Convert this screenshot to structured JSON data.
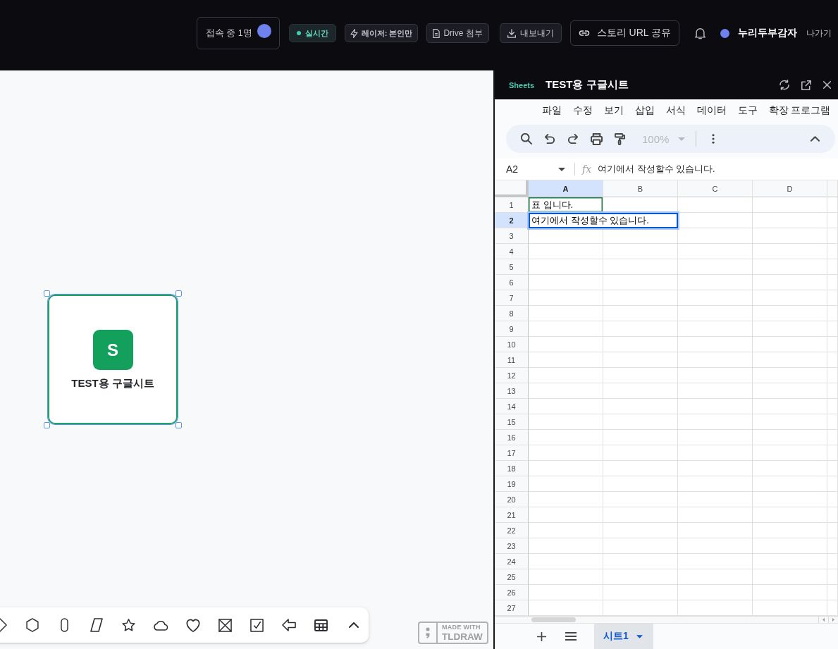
{
  "top_bar": {
    "presence": {
      "label": "접속 중 1명"
    },
    "actions": [
      {
        "kind": "live",
        "label": "실시간"
      },
      {
        "kind": "laser",
        "label": "레이저: 본인만"
      },
      {
        "kind": "drive",
        "label": "Drive 첨부"
      },
      {
        "kind": "export",
        "label": "내보내기"
      },
      {
        "kind": "share",
        "label": "스토리 URL 공유"
      }
    ],
    "user": {
      "name": "누리두부감자",
      "logout": "나가기"
    }
  },
  "canvas": {
    "card": {
      "icon_letter": "S",
      "title": "TEST용 구글시트",
      "selected": true
    },
    "tools": [
      {
        "kind": "diamond",
        "selected": false
      },
      {
        "kind": "hexagon",
        "selected": false
      },
      {
        "kind": "oval",
        "selected": false
      },
      {
        "kind": "rhombus",
        "selected": false
      },
      {
        "kind": "star",
        "selected": false
      },
      {
        "kind": "cloud",
        "selected": false
      },
      {
        "kind": "heart",
        "selected": false
      },
      {
        "kind": "x-box",
        "selected": false
      },
      {
        "kind": "check-box",
        "selected": false
      },
      {
        "kind": "arrow-left",
        "selected": false
      },
      {
        "kind": "table",
        "selected": false
      },
      {
        "kind": "expand",
        "selected": false
      }
    ],
    "badge": {
      "line_1": "MADE WITH",
      "line_2": "TLDRAW"
    }
  },
  "sheet_panel": {
    "app_label": "Sheets",
    "title": "TEST용 구글시트",
    "menu": [
      "파일",
      "수정",
      "보기",
      "삽입",
      "서식",
      "데이터",
      "도구",
      "확장 프로그램"
    ],
    "toolbar": {
      "zoom": "100%",
      "zoom_disabled": true
    },
    "name_box": "A2",
    "formula_label": "fx",
    "formula": "여기에서 작성할수 있습니다.",
    "columns": [
      {
        "label": "A",
        "selected": true
      },
      {
        "label": "B",
        "selected": false
      },
      {
        "label": "C",
        "selected": false
      },
      {
        "label": "D",
        "selected": false
      }
    ],
    "rows": [
      {
        "label": "1",
        "selected": false,
        "cells": [
          {
            "text": "표 입니다.",
            "outlined": true,
            "selected": false
          }
        ]
      },
      {
        "label": "2",
        "selected": true,
        "cells": [
          {
            "text": "여기에서 작성할수 있습니다.",
            "outlined": false,
            "selected": true
          }
        ]
      },
      {
        "label": "3",
        "selected": false
      },
      {
        "label": "4",
        "selected": false
      },
      {
        "label": "5",
        "selected": false
      },
      {
        "label": "6",
        "selected": false
      },
      {
        "label": "7",
        "selected": false
      },
      {
        "label": "8",
        "selected": false
      },
      {
        "label": "9",
        "selected": false
      },
      {
        "label": "10",
        "selected": false
      },
      {
        "label": "11",
        "selected": false
      },
      {
        "label": "12",
        "selected": false
      },
      {
        "label": "13",
        "selected": false
      },
      {
        "label": "14",
        "selected": false
      },
      {
        "label": "15",
        "selected": false
      },
      {
        "label": "16",
        "selected": false
      },
      {
        "label": "17",
        "selected": false
      },
      {
        "label": "18",
        "selected": false
      },
      {
        "label": "19",
        "selected": false
      },
      {
        "label": "20",
        "selected": false
      },
      {
        "label": "21",
        "selected": false
      },
      {
        "label": "22",
        "selected": false
      },
      {
        "label": "23",
        "selected": false
      },
      {
        "label": "24",
        "selected": false
      },
      {
        "label": "25",
        "selected": false
      },
      {
        "label": "26",
        "selected": false
      },
      {
        "label": "27",
        "selected": false
      }
    ],
    "sheet_tabs": [
      {
        "label": "시트1",
        "selected": true
      }
    ]
  }
}
